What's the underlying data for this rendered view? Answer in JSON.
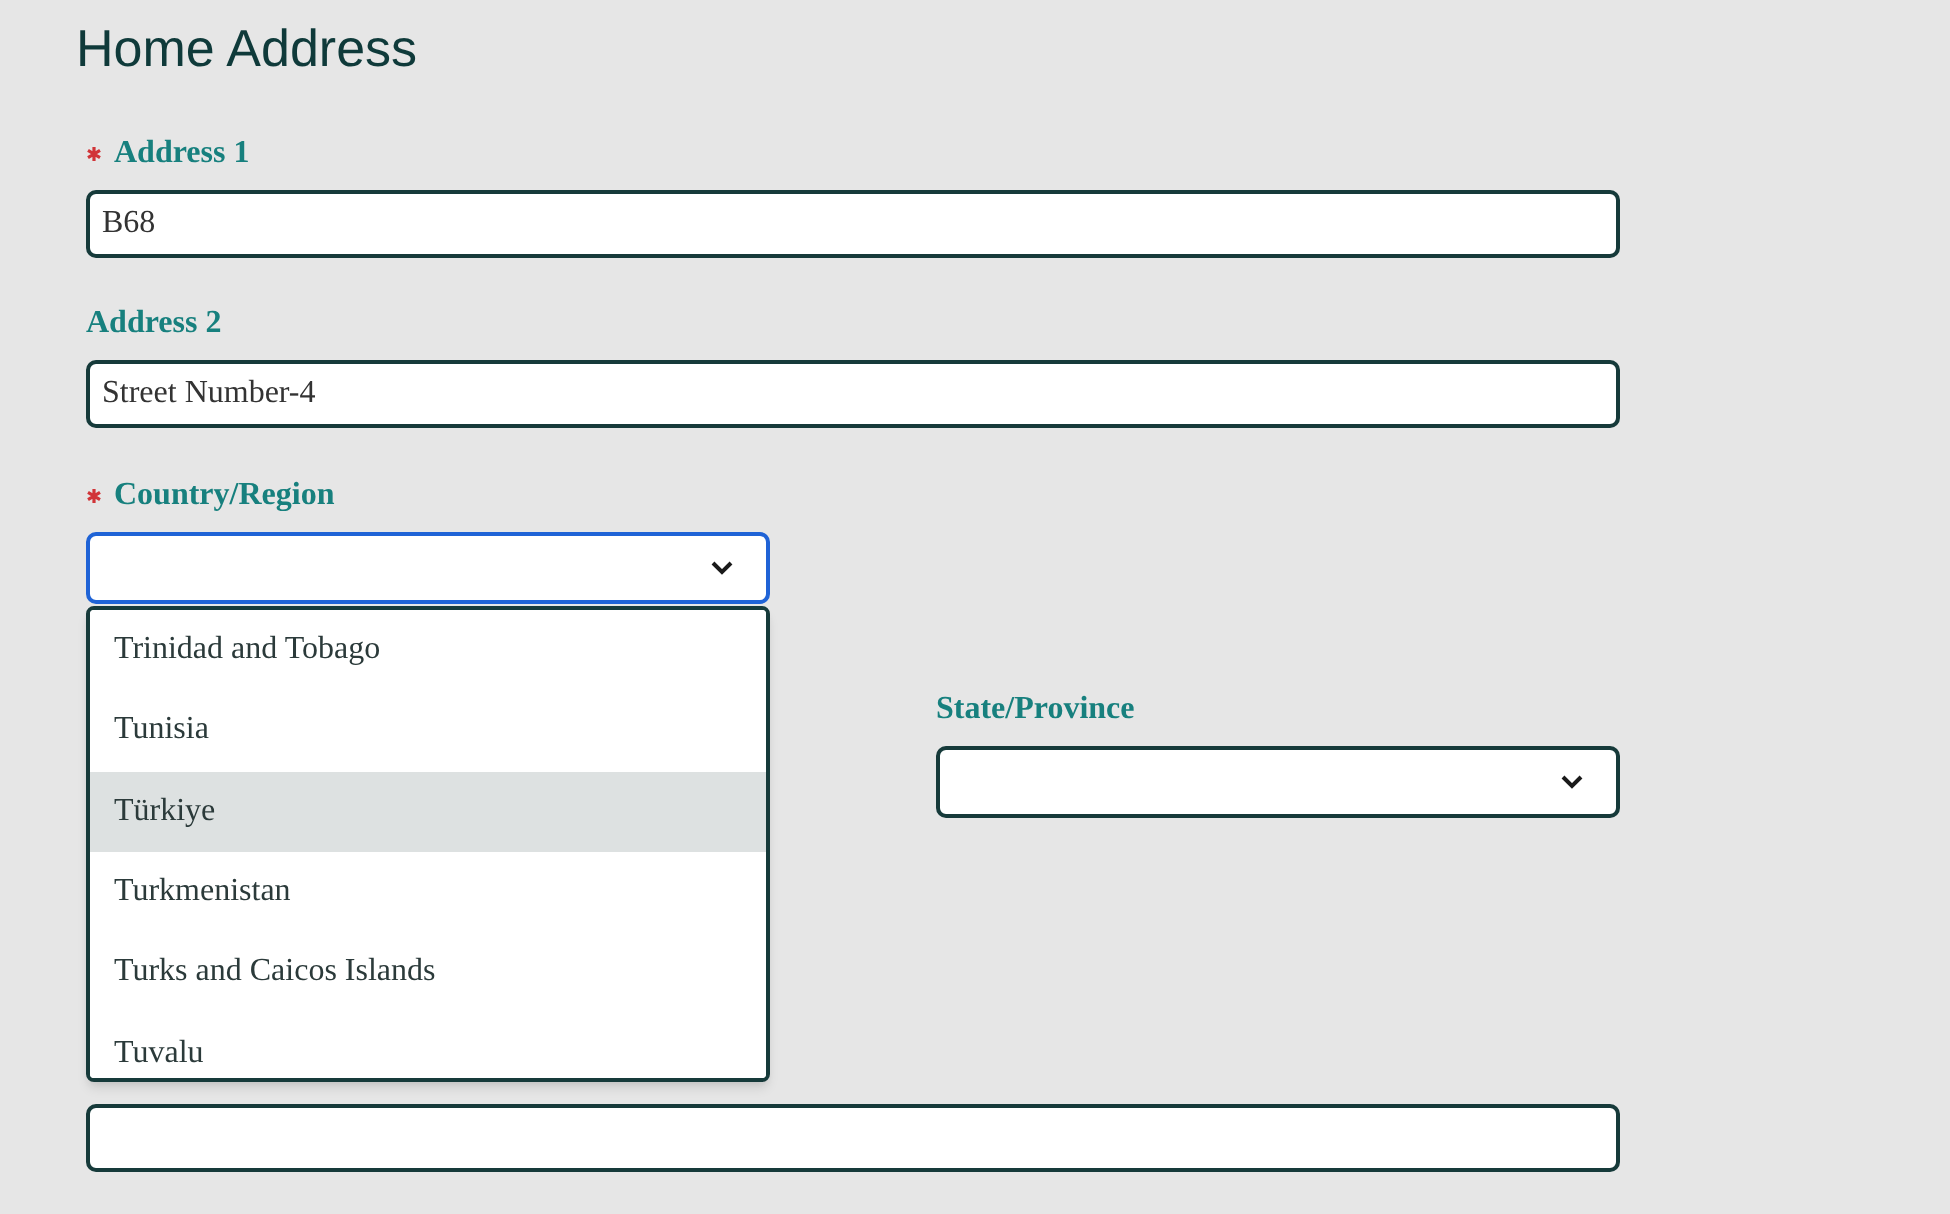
{
  "title": "Home Address",
  "fields": [
    {
      "kind": "text",
      "label": "Address 1",
      "required": true,
      "value": "B68",
      "focused": false
    },
    {
      "kind": "text",
      "label": "Address 2",
      "required": false,
      "value": "Street Number-4",
      "focused": false
    },
    {
      "kind": "select",
      "label": "Country/Region",
      "required": true,
      "focused": true
    },
    {
      "kind": "select",
      "label": "State/Province",
      "required": false,
      "focused": false
    },
    {
      "kind": "text",
      "focused": false
    }
  ],
  "dropdown_options": [
    {
      "label": "Trinidad and Tobago",
      "selected": false
    },
    {
      "label": "Tunisia",
      "selected": false
    },
    {
      "label": "Türkiye",
      "selected": true
    },
    {
      "label": "Turkmenistan",
      "selected": false
    },
    {
      "label": "Turks and Caicos Islands",
      "selected": false
    },
    {
      "label": "Tuvalu",
      "selected": false
    }
  ]
}
